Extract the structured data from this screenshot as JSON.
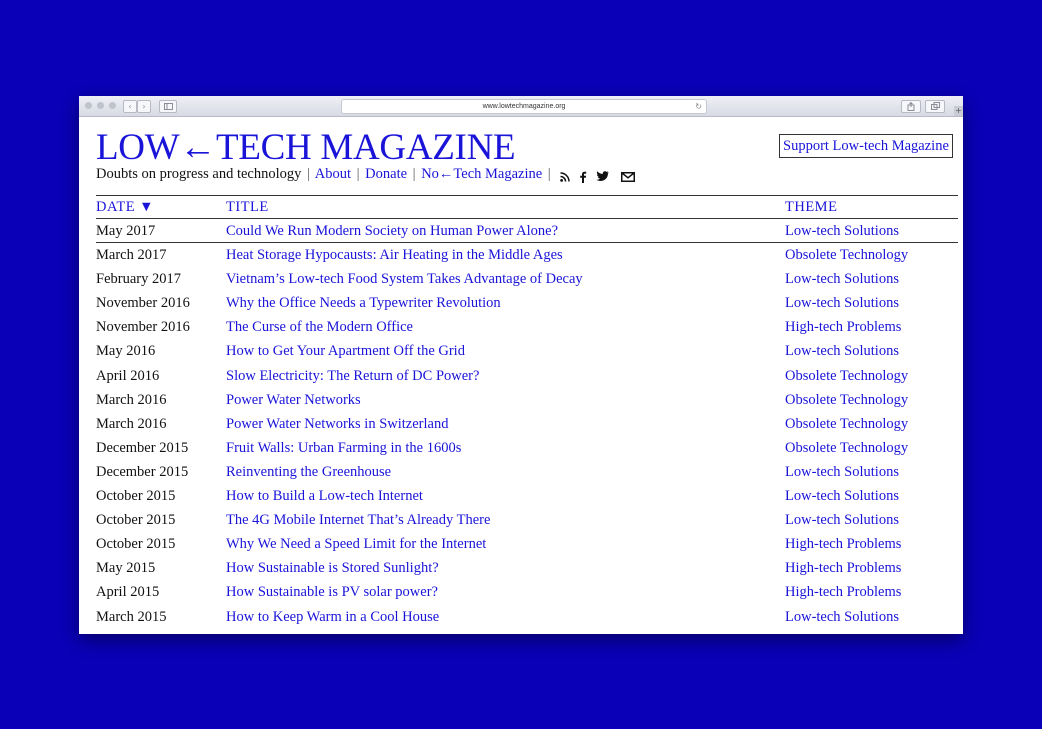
{
  "browser": {
    "url": "www.lowtechmagazine.org",
    "reload_icon": "reload-icon",
    "plus_label": "+"
  },
  "site": {
    "logo": "LOW←TECH MAGAZINE",
    "support_label": "Support Low-tech Magazine",
    "tagline": "Doubts on progress and technology",
    "links": {
      "about": "About",
      "donate": "Donate",
      "no_tech": "No←Tech Magazine"
    },
    "separator": "|",
    "social_icons": [
      "rss-icon",
      "facebook-icon",
      "twitter-icon",
      "mail-icon"
    ]
  },
  "table": {
    "headers": {
      "date": "DATE ▼",
      "title": "TITLE",
      "theme": "THEME"
    },
    "rows": [
      {
        "date": "May 2017",
        "title": "Could We Run Modern Society on Human Power Alone?",
        "theme": "Low-tech Solutions"
      },
      {
        "date": "March 2017",
        "title": "Heat Storage Hypocausts: Air Heating in the Middle Ages",
        "theme": "Obsolete Technology"
      },
      {
        "date": "February 2017",
        "title": "Vietnam’s Low-tech Food System Takes Advantage of Decay",
        "theme": "Low-tech Solutions"
      },
      {
        "date": "November 2016",
        "title": "Why the Office Needs a Typewriter Revolution",
        "theme": "Low-tech Solutions"
      },
      {
        "date": "November 2016",
        "title": "The Curse of the Modern Office",
        "theme": "High-tech Problems"
      },
      {
        "date": "May 2016",
        "title": "How to Get Your Apartment Off the Grid",
        "theme": "Low-tech Solutions"
      },
      {
        "date": "April 2016",
        "title": "Slow Electricity: The Return of DC Power?",
        "theme": "Obsolete Technology"
      },
      {
        "date": "March 2016",
        "title": "Power Water Networks",
        "theme": "Obsolete Technology"
      },
      {
        "date": "March 2016",
        "title": "Power Water Networks in Switzerland",
        "theme": "Obsolete Technology"
      },
      {
        "date": "December 2015",
        "title": "Fruit Walls: Urban Farming in the 1600s",
        "theme": "Obsolete Technology"
      },
      {
        "date": "December 2015",
        "title": "Reinventing the Greenhouse",
        "theme": "Low-tech Solutions"
      },
      {
        "date": "October 2015",
        "title": "How to Build a Low-tech Internet",
        "theme": "Low-tech Solutions"
      },
      {
        "date": "October 2015",
        "title": "The 4G Mobile Internet That’s Already There",
        "theme": "Low-tech Solutions"
      },
      {
        "date": "October 2015",
        "title": "Why We Need a Speed Limit for the Internet",
        "theme": "High-tech Problems"
      },
      {
        "date": "May 2015",
        "title": "How Sustainable is Stored Sunlight?",
        "theme": "High-tech Problems"
      },
      {
        "date": "April 2015",
        "title": "How Sustainable is PV solar power?",
        "theme": "High-tech Problems"
      },
      {
        "date": "March 2015",
        "title": "How to Keep Warm in a Cool House",
        "theme": "Low-tech Solutions"
      }
    ]
  },
  "colors": {
    "background": "#0a00b8",
    "link": "#1a14d9",
    "text": "#111111"
  }
}
